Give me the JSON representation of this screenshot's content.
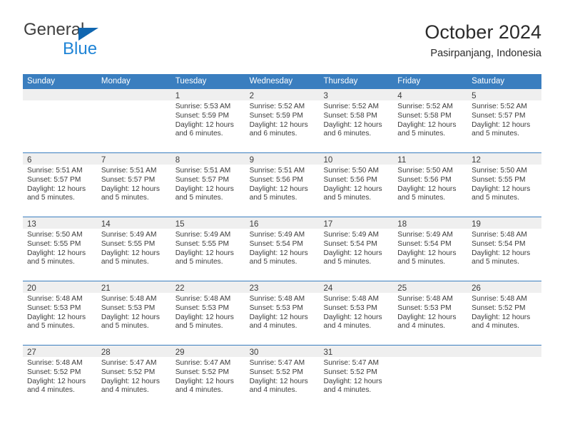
{
  "brand": {
    "name_top": "General",
    "name_bottom": "Blue",
    "triangle_color": "#1066b0",
    "blue_color": "#1f84d6",
    "top_color": "#3f3f3f"
  },
  "header": {
    "title": "October 2024",
    "subtitle": "Pasirpanjang, Indonesia"
  },
  "colors": {
    "header_blue": "#3a7ebf",
    "date_band": "#efefef",
    "text": "#3c3c3c",
    "cell_bg": "#ffffff"
  },
  "calendar": {
    "weekdays": [
      "Sunday",
      "Monday",
      "Tuesday",
      "Wednesday",
      "Thursday",
      "Friday",
      "Saturday"
    ],
    "weeks": [
      [
        {
          "date": "",
          "sunrise": "",
          "sunset": "",
          "daylight": ""
        },
        {
          "date": "",
          "sunrise": "",
          "sunset": "",
          "daylight": ""
        },
        {
          "date": "1",
          "sunrise": "Sunrise: 5:53 AM",
          "sunset": "Sunset: 5:59 PM",
          "daylight": "Daylight: 12 hours and 6 minutes."
        },
        {
          "date": "2",
          "sunrise": "Sunrise: 5:52 AM",
          "sunset": "Sunset: 5:59 PM",
          "daylight": "Daylight: 12 hours and 6 minutes."
        },
        {
          "date": "3",
          "sunrise": "Sunrise: 5:52 AM",
          "sunset": "Sunset: 5:58 PM",
          "daylight": "Daylight: 12 hours and 6 minutes."
        },
        {
          "date": "4",
          "sunrise": "Sunrise: 5:52 AM",
          "sunset": "Sunset: 5:58 PM",
          "daylight": "Daylight: 12 hours and 5 minutes."
        },
        {
          "date": "5",
          "sunrise": "Sunrise: 5:52 AM",
          "sunset": "Sunset: 5:57 PM",
          "daylight": "Daylight: 12 hours and 5 minutes."
        }
      ],
      [
        {
          "date": "6",
          "sunrise": "Sunrise: 5:51 AM",
          "sunset": "Sunset: 5:57 PM",
          "daylight": "Daylight: 12 hours and 5 minutes."
        },
        {
          "date": "7",
          "sunrise": "Sunrise: 5:51 AM",
          "sunset": "Sunset: 5:57 PM",
          "daylight": "Daylight: 12 hours and 5 minutes."
        },
        {
          "date": "8",
          "sunrise": "Sunrise: 5:51 AM",
          "sunset": "Sunset: 5:57 PM",
          "daylight": "Daylight: 12 hours and 5 minutes."
        },
        {
          "date": "9",
          "sunrise": "Sunrise: 5:51 AM",
          "sunset": "Sunset: 5:56 PM",
          "daylight": "Daylight: 12 hours and 5 minutes."
        },
        {
          "date": "10",
          "sunrise": "Sunrise: 5:50 AM",
          "sunset": "Sunset: 5:56 PM",
          "daylight": "Daylight: 12 hours and 5 minutes."
        },
        {
          "date": "11",
          "sunrise": "Sunrise: 5:50 AM",
          "sunset": "Sunset: 5:56 PM",
          "daylight": "Daylight: 12 hours and 5 minutes."
        },
        {
          "date": "12",
          "sunrise": "Sunrise: 5:50 AM",
          "sunset": "Sunset: 5:55 PM",
          "daylight": "Daylight: 12 hours and 5 minutes."
        }
      ],
      [
        {
          "date": "13",
          "sunrise": "Sunrise: 5:50 AM",
          "sunset": "Sunset: 5:55 PM",
          "daylight": "Daylight: 12 hours and 5 minutes."
        },
        {
          "date": "14",
          "sunrise": "Sunrise: 5:49 AM",
          "sunset": "Sunset: 5:55 PM",
          "daylight": "Daylight: 12 hours and 5 minutes."
        },
        {
          "date": "15",
          "sunrise": "Sunrise: 5:49 AM",
          "sunset": "Sunset: 5:55 PM",
          "daylight": "Daylight: 12 hours and 5 minutes."
        },
        {
          "date": "16",
          "sunrise": "Sunrise: 5:49 AM",
          "sunset": "Sunset: 5:54 PM",
          "daylight": "Daylight: 12 hours and 5 minutes."
        },
        {
          "date": "17",
          "sunrise": "Sunrise: 5:49 AM",
          "sunset": "Sunset: 5:54 PM",
          "daylight": "Daylight: 12 hours and 5 minutes."
        },
        {
          "date": "18",
          "sunrise": "Sunrise: 5:49 AM",
          "sunset": "Sunset: 5:54 PM",
          "daylight": "Daylight: 12 hours and 5 minutes."
        },
        {
          "date": "19",
          "sunrise": "Sunrise: 5:48 AM",
          "sunset": "Sunset: 5:54 PM",
          "daylight": "Daylight: 12 hours and 5 minutes."
        }
      ],
      [
        {
          "date": "20",
          "sunrise": "Sunrise: 5:48 AM",
          "sunset": "Sunset: 5:53 PM",
          "daylight": "Daylight: 12 hours and 5 minutes."
        },
        {
          "date": "21",
          "sunrise": "Sunrise: 5:48 AM",
          "sunset": "Sunset: 5:53 PM",
          "daylight": "Daylight: 12 hours and 5 minutes."
        },
        {
          "date": "22",
          "sunrise": "Sunrise: 5:48 AM",
          "sunset": "Sunset: 5:53 PM",
          "daylight": "Daylight: 12 hours and 5 minutes."
        },
        {
          "date": "23",
          "sunrise": "Sunrise: 5:48 AM",
          "sunset": "Sunset: 5:53 PM",
          "daylight": "Daylight: 12 hours and 4 minutes."
        },
        {
          "date": "24",
          "sunrise": "Sunrise: 5:48 AM",
          "sunset": "Sunset: 5:53 PM",
          "daylight": "Daylight: 12 hours and 4 minutes."
        },
        {
          "date": "25",
          "sunrise": "Sunrise: 5:48 AM",
          "sunset": "Sunset: 5:53 PM",
          "daylight": "Daylight: 12 hours and 4 minutes."
        },
        {
          "date": "26",
          "sunrise": "Sunrise: 5:48 AM",
          "sunset": "Sunset: 5:52 PM",
          "daylight": "Daylight: 12 hours and 4 minutes."
        }
      ],
      [
        {
          "date": "27",
          "sunrise": "Sunrise: 5:48 AM",
          "sunset": "Sunset: 5:52 PM",
          "daylight": "Daylight: 12 hours and 4 minutes."
        },
        {
          "date": "28",
          "sunrise": "Sunrise: 5:47 AM",
          "sunset": "Sunset: 5:52 PM",
          "daylight": "Daylight: 12 hours and 4 minutes."
        },
        {
          "date": "29",
          "sunrise": "Sunrise: 5:47 AM",
          "sunset": "Sunset: 5:52 PM",
          "daylight": "Daylight: 12 hours and 4 minutes."
        },
        {
          "date": "30",
          "sunrise": "Sunrise: 5:47 AM",
          "sunset": "Sunset: 5:52 PM",
          "daylight": "Daylight: 12 hours and 4 minutes."
        },
        {
          "date": "31",
          "sunrise": "Sunrise: 5:47 AM",
          "sunset": "Sunset: 5:52 PM",
          "daylight": "Daylight: 12 hours and 4 minutes."
        },
        {
          "date": "",
          "sunrise": "",
          "sunset": "",
          "daylight": ""
        },
        {
          "date": "",
          "sunrise": "",
          "sunset": "",
          "daylight": ""
        }
      ]
    ]
  }
}
